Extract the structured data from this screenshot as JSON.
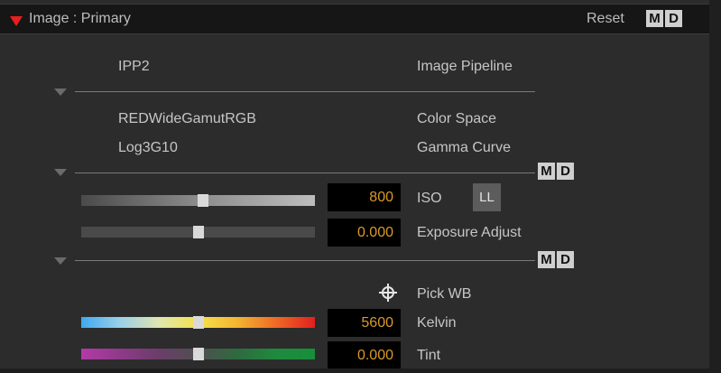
{
  "header": {
    "title": "Image : Primary",
    "reset_label": "Reset",
    "m_label": "M",
    "d_label": "D",
    "accent_color": "#e81f1f"
  },
  "pipeline": {
    "value": "IPP2",
    "label": "Image Pipeline"
  },
  "color": {
    "space_value": "REDWideGamutRGB",
    "space_label": "Color Space",
    "gamma_value": "Log3G10",
    "gamma_label": "Gamma Curve",
    "m_label": "M",
    "d_label": "D"
  },
  "exposure": {
    "iso_value": "800",
    "iso_label": "ISO",
    "ll_label": "LL",
    "iso_slider_level": 0.5,
    "exposure_value": "0.000",
    "exposure_label": "Exposure Adjust",
    "exposure_slider_level": 0.5,
    "m_label": "M",
    "d_label": "D"
  },
  "white_balance": {
    "pick_label": "Pick WB",
    "pick_icon": "crosshair-icon",
    "kelvin_value": "5600",
    "kelvin_label": "Kelvin",
    "kelvin_slider_level": 0.5,
    "tint_value": "0.000",
    "tint_label": "Tint",
    "tint_slider_level": 0.5
  },
  "colors": {
    "value_text": "#d99a2a",
    "label_text": "#c6c6c6",
    "panel_bg": "#2c2c2c"
  }
}
